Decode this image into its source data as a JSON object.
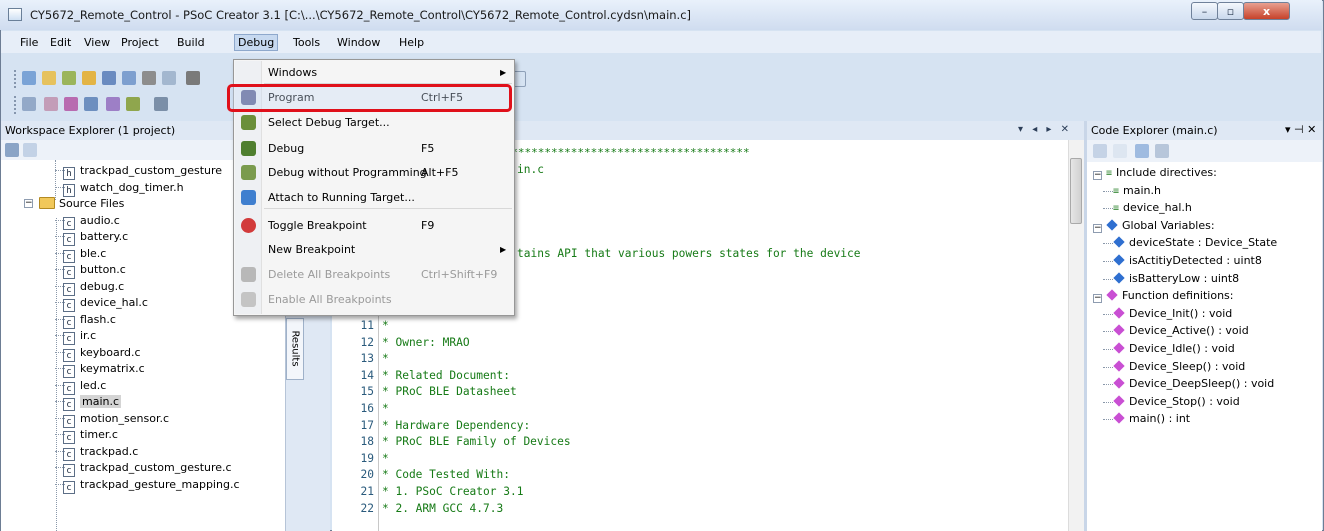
{
  "window": {
    "title": "CY5672_Remote_Control - PSoC Creator 3.1  [C:\\...\\CY5672_Remote_Control\\CY5672_Remote_Control.cydsn\\main.c]",
    "minimize": "–",
    "maximize": "▫",
    "close": "x"
  },
  "menubar": {
    "file": "File",
    "edit": "Edit",
    "view": "View",
    "project": "Project",
    "build": "Build",
    "debug": "Debug",
    "tools": "Tools",
    "window": "Window",
    "help": "Help"
  },
  "debug_menu": {
    "items": [
      {
        "label": "Windows",
        "shortcut": "",
        "submenu": true,
        "enabled": true,
        "icon": ""
      },
      {
        "label": "Program",
        "shortcut": "Ctrl+F5",
        "submenu": false,
        "enabled": true,
        "icon": "program-chip-icon"
      },
      {
        "label": "Select Debug Target...",
        "shortcut": "",
        "submenu": false,
        "enabled": true,
        "icon": "debug-target-icon"
      },
      {
        "label": "Debug",
        "shortcut": "F5",
        "submenu": false,
        "enabled": true,
        "icon": "bug-icon"
      },
      {
        "label": "Debug without Programming",
        "shortcut": "Alt+F5",
        "submenu": false,
        "enabled": true,
        "icon": "bug-no-program-icon"
      },
      {
        "label": "Attach to Running Target...",
        "shortcut": "",
        "submenu": false,
        "enabled": true,
        "icon": "attach-icon"
      },
      {
        "label": "Toggle Breakpoint",
        "shortcut": "F9",
        "submenu": false,
        "enabled": true,
        "icon": "breakpoint-icon"
      },
      {
        "label": "New Breakpoint",
        "shortcut": "",
        "submenu": true,
        "enabled": true,
        "icon": ""
      },
      {
        "label": "Delete All Breakpoints",
        "shortcut": "Ctrl+Shift+F9",
        "submenu": false,
        "enabled": false,
        "icon": "delete-breakpoints-icon"
      },
      {
        "label": "Enable All Breakpoints",
        "shortcut": "",
        "submenu": false,
        "enabled": false,
        "icon": "enable-breakpoints-icon"
      }
    ]
  },
  "workspace": {
    "title": "Workspace Explorer (1 project)",
    "tree": [
      {
        "name": "trackpad_custom_gesture",
        "type": "h"
      },
      {
        "name": "watch_dog_timer.h",
        "type": "h"
      },
      {
        "name": "Source Files",
        "type": "folder"
      },
      {
        "name": "audio.c",
        "type": "c"
      },
      {
        "name": "battery.c",
        "type": "c"
      },
      {
        "name": "ble.c",
        "type": "c"
      },
      {
        "name": "button.c",
        "type": "c"
      },
      {
        "name": "debug.c",
        "type": "c"
      },
      {
        "name": "device_hal.c",
        "type": "c"
      },
      {
        "name": "flash.c",
        "type": "c"
      },
      {
        "name": "ir.c",
        "type": "c"
      },
      {
        "name": "keyboard.c",
        "type": "c"
      },
      {
        "name": "keymatrix.c",
        "type": "c"
      },
      {
        "name": "led.c",
        "type": "c"
      },
      {
        "name": "main.c",
        "type": "c",
        "selected": true
      },
      {
        "name": "motion_sensor.c",
        "type": "c"
      },
      {
        "name": "timer.c",
        "type": "c"
      },
      {
        "name": "trackpad.c",
        "type": "c"
      },
      {
        "name": "trackpad_custom_gesture.c",
        "type": "c"
      },
      {
        "name": "trackpad_gesture_mapping.c",
        "type": "c"
      }
    ]
  },
  "results_tab": "Results",
  "editor": {
    "header_controls": "▾ ◂ ▸ ✕",
    "stars": "******************************************************",
    "partial_filename": "in.c",
    "partial_desc": "tains API that various powers states for the device",
    "lines": [
      {
        "n": "11",
        "text": "*"
      },
      {
        "n": "12",
        "text": "* Owner: MRAO"
      },
      {
        "n": "13",
        "text": "*"
      },
      {
        "n": "14",
        "text": "* Related Document:"
      },
      {
        "n": "15",
        "text": "* PRoC BLE Datasheet"
      },
      {
        "n": "16",
        "text": "*"
      },
      {
        "n": "17",
        "text": "* Hardware Dependency:"
      },
      {
        "n": "18",
        "text": "* PRoC BLE Family of Devices"
      },
      {
        "n": "19",
        "text": "*"
      },
      {
        "n": "20",
        "text": "* Code Tested With:"
      },
      {
        "n": "21",
        "text": "* 1. PSoC Creator 3.1"
      },
      {
        "n": "22",
        "text": "* 2. ARM GCC 4.7.3"
      }
    ]
  },
  "code_explorer": {
    "title": "Code Explorer (main.c)",
    "header_controls": "▾ ⊣ ✕",
    "include_group": "Include directives:",
    "includes": [
      "main.h",
      "device_hal.h"
    ],
    "globals_group": "Global Variables:",
    "globals": [
      "deviceState : Device_State",
      "isActitiyDetected : uint8",
      "isBatteryLow : uint8"
    ],
    "functions_group": "Function definitions:",
    "functions": [
      "Device_Init() : void",
      "Device_Active() : void",
      "Device_Idle() : void",
      "Device_Sleep() : void",
      "Device_DeepSleep() : void",
      "Device_Stop() : void",
      "main() : int"
    ]
  },
  "colors": {
    "highlight_border": "#e0101a",
    "comment": "#167a16",
    "chrome": "#d6e3f2"
  }
}
